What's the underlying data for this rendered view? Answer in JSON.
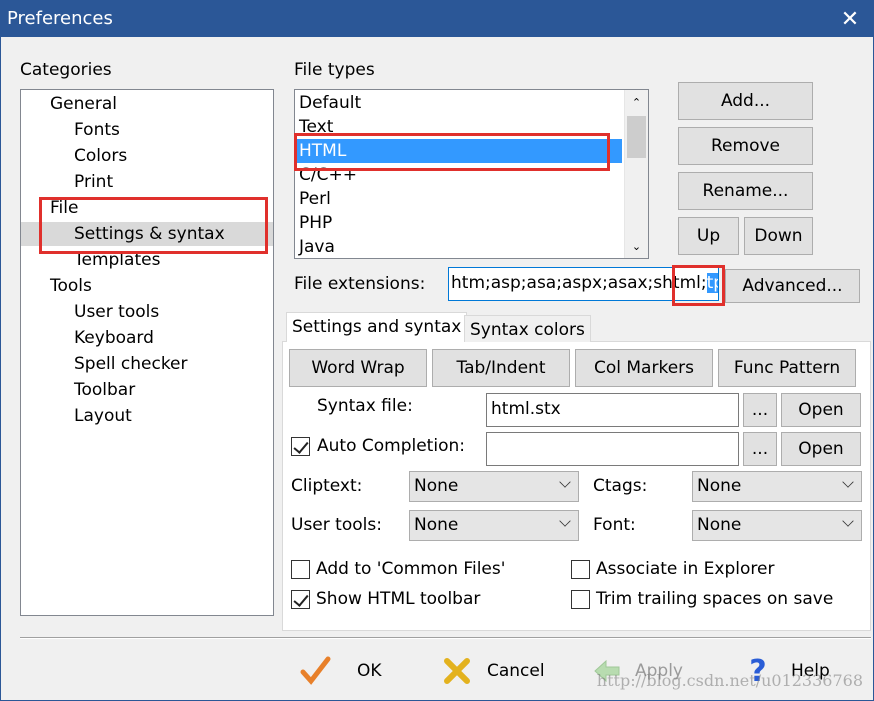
{
  "window": {
    "title": "Preferences",
    "close_glyph": "✕"
  },
  "categories": {
    "label": "Categories",
    "items": [
      {
        "label": "General",
        "level": 0
      },
      {
        "label": "Fonts",
        "level": 1
      },
      {
        "label": "Colors",
        "level": 1
      },
      {
        "label": "Print",
        "level": 1
      },
      {
        "label": "File",
        "level": 0
      },
      {
        "label": "Settings & syntax",
        "level": 1,
        "selected": true
      },
      {
        "label": "Templates",
        "level": 1
      },
      {
        "label": "Tools",
        "level": 0
      },
      {
        "label": "User tools",
        "level": 1
      },
      {
        "label": "Keyboard",
        "level": 1
      },
      {
        "label": "Spell checker",
        "level": 1
      },
      {
        "label": "Toolbar",
        "level": 1
      },
      {
        "label": "Layout",
        "level": 1
      }
    ]
  },
  "file_types": {
    "label": "File types",
    "items": [
      "Default",
      "Text",
      "HTML",
      "C/C++",
      "Perl",
      "PHP",
      "Java"
    ],
    "selected": "HTML"
  },
  "side_buttons": {
    "add": "Add...",
    "remove": "Remove",
    "rename": "Rename...",
    "up": "Up",
    "down": "Down"
  },
  "extensions": {
    "label": "File extensions:",
    "value": "htm;asp;asa;aspx;asax;shtml;",
    "selected_text": "tpl",
    "advanced": "Advanced..."
  },
  "tabs": [
    "Settings and syntax",
    "Syntax colors"
  ],
  "tab_buttons": {
    "word_wrap": "Word Wrap",
    "tab_indent": "Tab/Indent",
    "col_markers": "Col Markers",
    "func_pattern": "Func Pattern"
  },
  "syntax_file": {
    "label": "Syntax file:",
    "value": "html.stx",
    "browse": "...",
    "open": "Open"
  },
  "auto_completion": {
    "label": "Auto Completion:",
    "value": "",
    "checked": true,
    "browse": "...",
    "open": "Open"
  },
  "combos": {
    "cliptext": {
      "label": "Cliptext:",
      "value": "None"
    },
    "ctags": {
      "label": "Ctags:",
      "value": "None"
    },
    "user_tools": {
      "label": "User tools:",
      "value": "None"
    },
    "font": {
      "label": "Font:",
      "value": "None"
    }
  },
  "checks": {
    "common_files": {
      "label": "Add to 'Common Files'",
      "checked": false
    },
    "explorer": {
      "label": "Associate in Explorer",
      "checked": false
    },
    "html_toolbar": {
      "label": "Show HTML toolbar",
      "checked": true
    },
    "trim_spaces": {
      "label": "Trim trailing spaces on save",
      "checked": false
    }
  },
  "footer": {
    "ok": "OK",
    "cancel": "Cancel",
    "apply": "Apply",
    "help": "Help"
  },
  "watermark": "http://blog.csdn.net/u012336768",
  "colors": {
    "accent": "#2b5797",
    "selection": "#3399ff",
    "highlight_box": "#e0302c"
  }
}
